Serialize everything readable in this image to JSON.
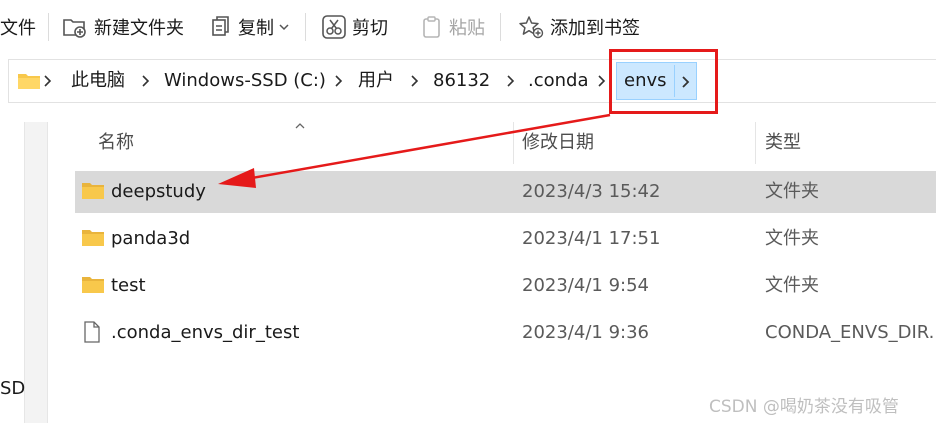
{
  "toolbar": {
    "file_label": "文件",
    "new_folder_label": "新建文件夹",
    "copy_label": "复制",
    "cut_label": "剪切",
    "paste_label": "粘贴",
    "bookmark_label": "添加到书签"
  },
  "breadcrumb": {
    "items": [
      "此电脑",
      "Windows-SSD (C:)",
      "用户",
      "86132",
      ".conda",
      "envs"
    ]
  },
  "columns": {
    "name": "名称",
    "date": "修改日期",
    "type": "类型"
  },
  "files": [
    {
      "name": "deepstudy",
      "date": "2023/4/3 15:42",
      "type": "文件夹",
      "kind": "folder-icon",
      "selected": true
    },
    {
      "name": "panda3d",
      "date": "2023/4/1 17:51",
      "type": "文件夹",
      "kind": "folder-icon",
      "selected": false
    },
    {
      "name": "test",
      "date": "2023/4/1 9:54",
      "type": "文件夹",
      "kind": "folder-icon",
      "selected": false
    },
    {
      "name": ".conda_envs_dir_test",
      "date": "2023/4/1 9:36",
      "type": "CONDA_ENVS_DIR...",
      "kind": "file-icon",
      "selected": false
    }
  ],
  "nav": {
    "ssd_label": "SD"
  },
  "watermark": "CSDN @喝奶茶没有吸管",
  "colors": {
    "selection": "#d9d9d9",
    "highlight": "#cce8ff",
    "annotation": "#e51a1a",
    "folder": "#f8c84b"
  }
}
